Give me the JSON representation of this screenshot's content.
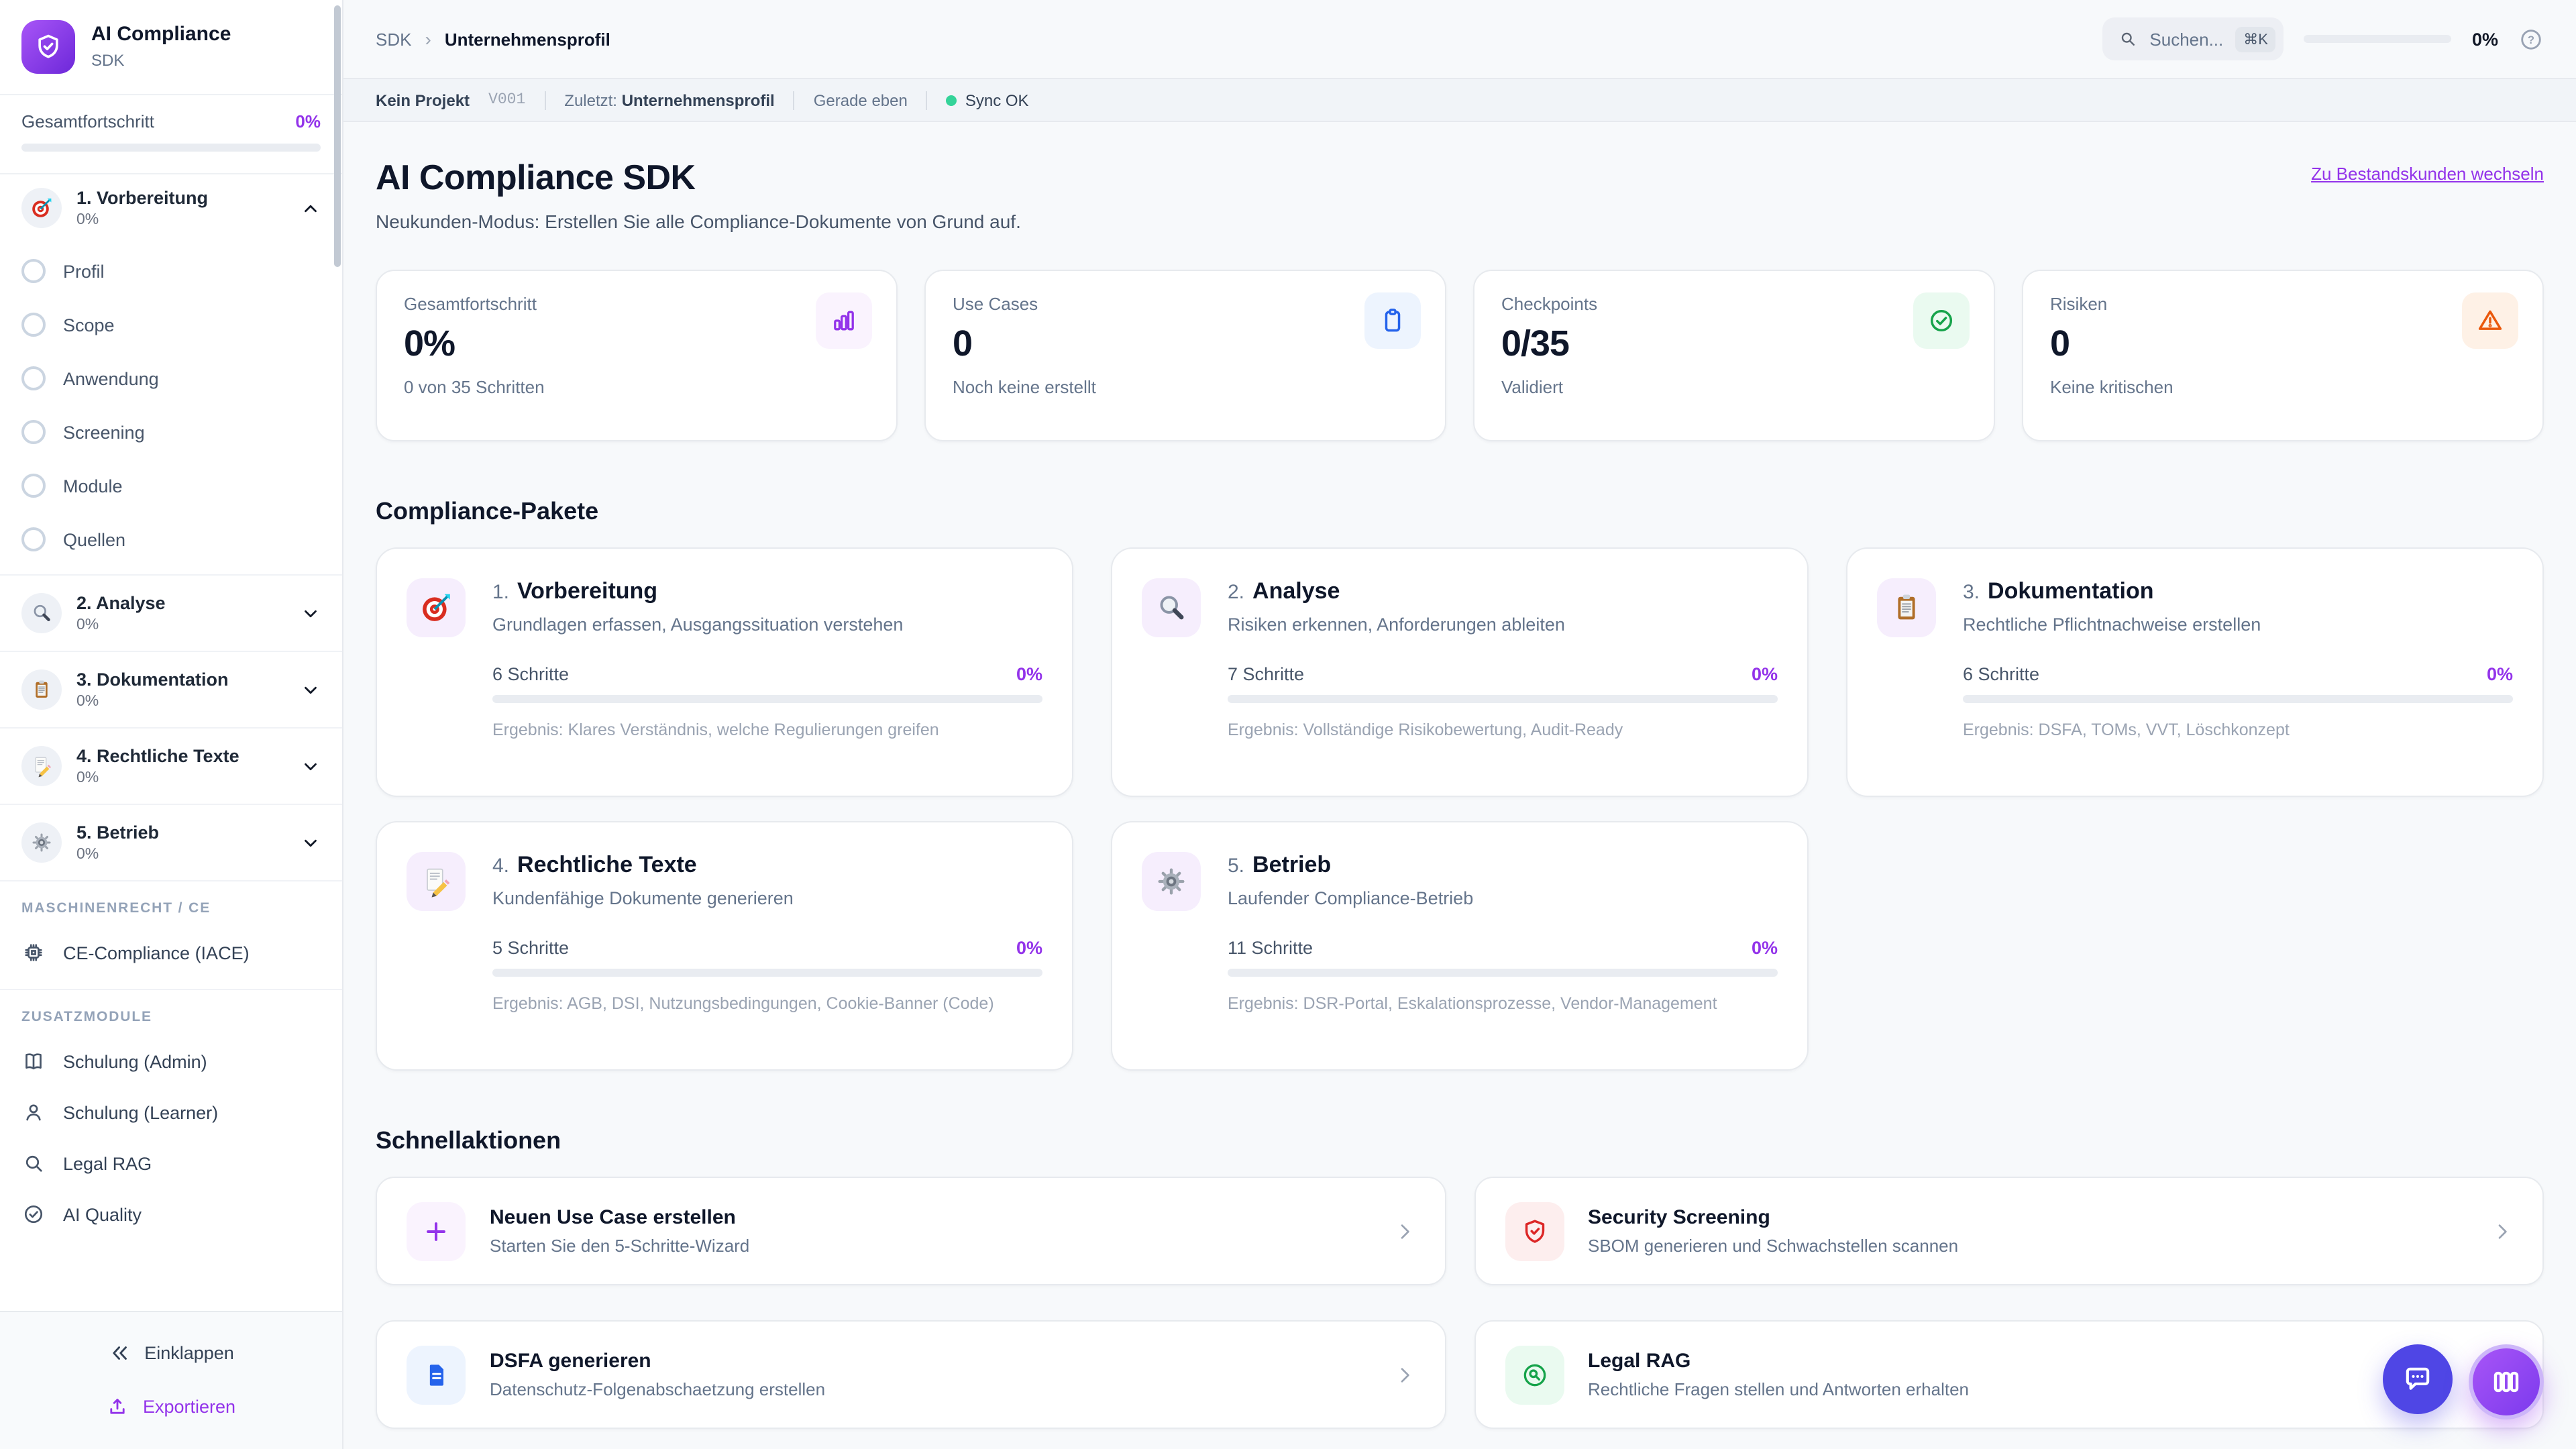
{
  "sidebar": {
    "brand_title": "AI Compliance",
    "brand_subtitle": "SDK",
    "overall_label": "Gesamtfortschritt",
    "overall_value": "0%",
    "phases": [
      {
        "name": "1. Vorbereitung",
        "pct": "0%"
      },
      {
        "name": "2. Analyse",
        "pct": "0%"
      },
      {
        "name": "3. Dokumentation",
        "pct": "0%"
      },
      {
        "name": "4. Rechtliche Texte",
        "pct": "0%"
      },
      {
        "name": "5. Betrieb",
        "pct": "0%"
      }
    ],
    "steps": [
      "Profil",
      "Scope",
      "Anwendung",
      "Screening",
      "Module",
      "Quellen"
    ],
    "section_machine": "MASCHINENRECHT / CE",
    "item_ce": "CE-Compliance (IACE)",
    "section_addons": "ZUSATZMODULE",
    "addons": [
      "Schulung (Admin)",
      "Schulung (Learner)",
      "Legal RAG",
      "AI Quality"
    ],
    "collapse_label": "Einklappen",
    "export_label": "Exportieren"
  },
  "topbar": {
    "breadcrumb_root": "SDK",
    "breadcrumb_sep": "›",
    "breadcrumb_current": "Unternehmensprofil",
    "search_placeholder": "Suchen...",
    "search_kbd": "⌘K",
    "progress_value": "0%"
  },
  "statusbar": {
    "project": "Kein Projekt",
    "version": "V001",
    "last_label": "Zuletzt:",
    "last_value": "Unternehmensprofil",
    "time": "Gerade eben",
    "sync": "Sync OK"
  },
  "header": {
    "title": "AI Compliance SDK",
    "subtitle": "Neukunden-Modus: Erstellen Sie alle Compliance-Dokumente von Grund auf.",
    "switch_link": "Zu Bestandskunden wechseln"
  },
  "stats": [
    {
      "label": "Gesamtfortschritt",
      "value": "0%",
      "sub": "0 von 35 Schritten"
    },
    {
      "label": "Use Cases",
      "value": "0",
      "sub": "Noch keine erstellt"
    },
    {
      "label": "Checkpoints",
      "value": "0/35",
      "sub": "Validiert"
    },
    {
      "label": "Risiken",
      "value": "0",
      "sub": "Keine kritischen"
    }
  ],
  "packages": {
    "heading": "Compliance-Pakete",
    "items": [
      {
        "num": "1.",
        "title": "Vorbereitung",
        "desc": "Grundlagen erfassen, Ausgangssituation verstehen",
        "steps": "6 Schritte",
        "pct": "0%",
        "result": "Ergebnis: Klares Verständnis, welche Regulierungen greifen"
      },
      {
        "num": "2.",
        "title": "Analyse",
        "desc": "Risiken erkennen, Anforderungen ableiten",
        "steps": "7 Schritte",
        "pct": "0%",
        "result": "Ergebnis: Vollständige Risikobewertung, Audit-Ready"
      },
      {
        "num": "3.",
        "title": "Dokumentation",
        "desc": "Rechtliche Pflichtnachweise erstellen",
        "steps": "6 Schritte",
        "pct": "0%",
        "result": "Ergebnis: DSFA, TOMs, VVT, Löschkonzept"
      },
      {
        "num": "4.",
        "title": "Rechtliche Texte",
        "desc": "Kundenfähige Dokumente generieren",
        "steps": "5 Schritte",
        "pct": "0%",
        "result": "Ergebnis: AGB, DSI, Nutzungsbedingungen, Cookie-Banner (Code)"
      },
      {
        "num": "5.",
        "title": "Betrieb",
        "desc": "Laufender Compliance-Betrieb",
        "steps": "11 Schritte",
        "pct": "0%",
        "result": "Ergebnis: DSR-Portal, Eskalationsprozesse, Vendor-Management"
      }
    ]
  },
  "quick": {
    "heading": "Schnellaktionen",
    "actions": [
      {
        "title": "Neuen Use Case erstellen",
        "sub": "Starten Sie den 5-Schritte-Wizard"
      },
      {
        "title": "Security Screening",
        "sub": "SBOM generieren und Schwachstellen scannen"
      },
      {
        "title": "DSFA generieren",
        "sub": "Datenschutz-Folgenabschaetzung erstellen"
      },
      {
        "title": "Legal RAG",
        "sub": "Rechtliche Fragen stellen und Antworten erhalten"
      }
    ]
  },
  "icons": {
    "logo": "shield-check",
    "phase_1": "target",
    "phase_2": "magnifier",
    "phase_3": "clipboard",
    "phase_4": "memo-pencil",
    "phase_5": "gear",
    "stat_1": "bar-chart",
    "stat_2": "clipboard",
    "stat_3": "check-circle",
    "stat_4": "warning-triangle",
    "action_1": "plus",
    "action_2": "shield-check",
    "action_3": "file-text",
    "action_4": "search-circle",
    "fab_1": "chat-bubble",
    "fab_2": "columns"
  },
  "colors": {
    "accent": "#9333ea",
    "logo_from": "#a855f7",
    "logo_to": "#6d28d9",
    "sync_green": "#34d399",
    "stat_purple": "#9333ea",
    "stat_blue": "#2563eb",
    "stat_green": "#16a34a",
    "stat_orange": "#ea580c",
    "security_red": "#dc2626",
    "chat_fab": "#4f46e5",
    "cols_fab_from": "#a855f7",
    "cols_fab_to": "#7c3aed"
  }
}
